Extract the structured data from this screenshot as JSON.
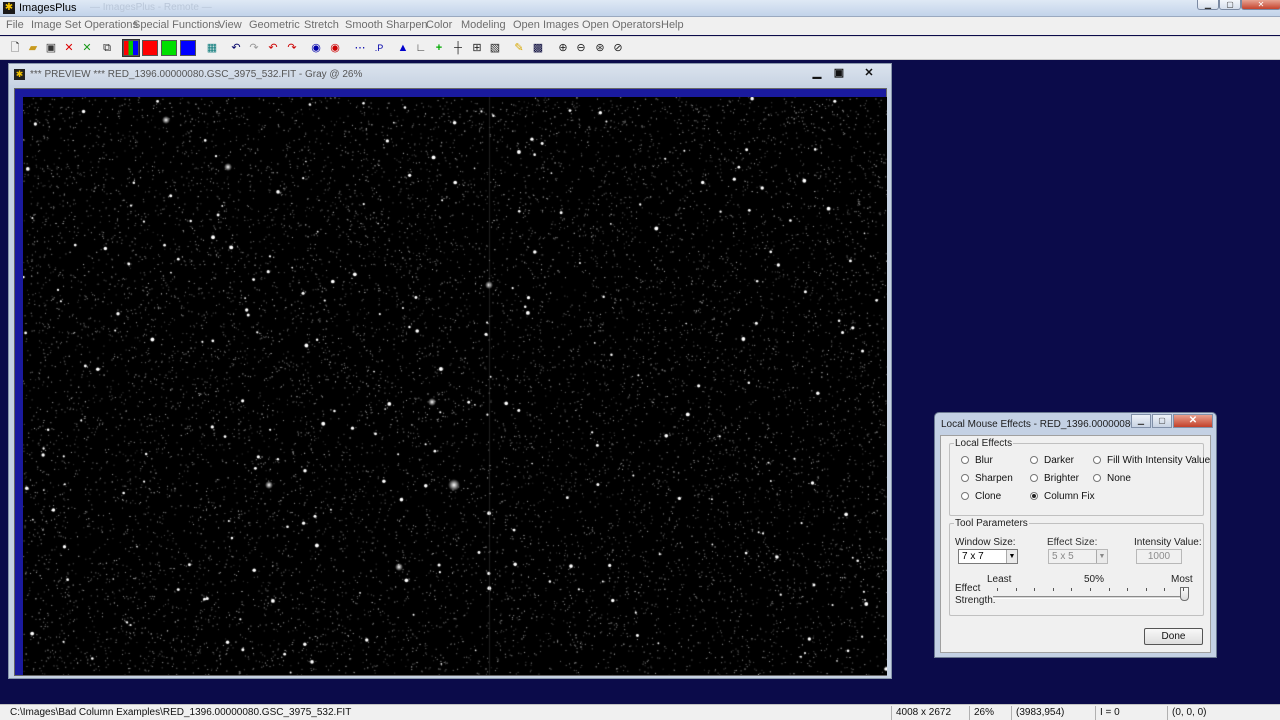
{
  "app": {
    "title": "ImagesPlus",
    "ghost_text": "— ImagesPlus - Remote —"
  },
  "menu": [
    "File",
    "Image Set Operations",
    "Special Functions",
    "View",
    "Geometric",
    "Stretch",
    "Smooth Sharpen",
    "Color",
    "Modeling",
    "Open Images",
    "Open Operators",
    "Help"
  ],
  "toolbar": {
    "icons": [
      "new-file-icon",
      "open-folder-icon",
      "save-icon",
      "close-red-x-icon",
      "close-green-x-icon",
      "copy-window-icon",
      "rgb-bars-icon",
      "red-channel-icon",
      "green-channel-icon",
      "blue-channel-icon",
      "grid-select-icon",
      "undo-icon",
      "redo-icon",
      "undo-red-icon",
      "redo-red-icon",
      "circle-select-icon",
      "circle-target-icon",
      "dotted-line-icon",
      "point-p-icon",
      "triangle-icon",
      "level-icon",
      "plus-cross-icon",
      "crosshair-icon",
      "table-icon",
      "image-edit-icon",
      "pencil-icon",
      "grid-icon",
      "zoom-in-icon",
      "zoom-out-icon",
      "zoom-fit-icon",
      "zoom-reset-icon"
    ],
    "colors": {
      "red": "#ff0000",
      "green": "#00e000",
      "blue": "#0000ff"
    }
  },
  "preview": {
    "title": "*** PREVIEW *** RED_1396.00000080.GSC_3975_532.FIT - Gray @ 26%"
  },
  "dialog": {
    "title": "Local Mouse Effects - RED_1396.00000080...",
    "local_effects_label": "Local Effects",
    "effects": [
      {
        "label": "Blur",
        "selected": false
      },
      {
        "label": "Darker",
        "selected": false
      },
      {
        "label": "Fill With Intensity Value",
        "selected": false
      },
      {
        "label": "Sharpen",
        "selected": false
      },
      {
        "label": "Brighter",
        "selected": false
      },
      {
        "label": "None",
        "selected": false
      },
      {
        "label": "Clone",
        "selected": false
      },
      {
        "label": "Column Fix",
        "selected": true
      }
    ],
    "tool_params_label": "Tool Parameters",
    "window_size_label": "Window Size:",
    "window_size_value": "7 x 7",
    "effect_size_label": "Effect Size:",
    "effect_size_value": "5 x 5",
    "intensity_label": "Intensity Value:",
    "intensity_value": "1000",
    "effect_label": "Effect",
    "strength_label": "Strength:",
    "least_label": "Least",
    "mid_label": "50%",
    "most_label": "Most",
    "strength_level": 1.0,
    "done_label": "Done"
  },
  "status": {
    "path": "C:\\Images\\Bad Column Examples\\RED_1396.00000080.GSC_3975_532.FIT",
    "dimensions": "4008 x 2672",
    "zoom": "26%",
    "coords": "(3983,954)",
    "intensity": "I = 0",
    "rgb": "(0, 0, 0)"
  }
}
